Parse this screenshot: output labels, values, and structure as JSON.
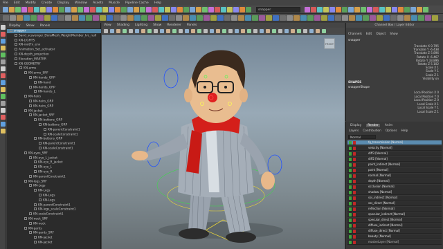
{
  "menubar": {
    "items": [
      "File",
      "Edit",
      "Modify",
      "Create",
      "Display",
      "Window",
      "Assets",
      "Muscle",
      "Pipeline Cache",
      "Help"
    ]
  },
  "shelf": {
    "search_value": "snapper"
  },
  "outliner": {
    "menu": [
      "Display",
      "Show",
      "Panels"
    ],
    "rows": [
      "snapper",
      "Sand_scavenger_DoraMesh_WeightMember_Ivc_null",
      "KN-LIGHTS",
      "KN-rootFx_env",
      "Animation_Set_activator",
      "KN-depth_projection",
      "Elevation_MASTER",
      "KN-GEOMETRY",
      "KN-arms",
      "KN-arms_SRF",
      "KN-hands_GRP",
      "KN-hand",
      "KN-hands_GRP",
      "KN-hands_L",
      "KN-hairs",
      "KN-hairs_GRP",
      "KN-hairs_GRP",
      "KN-jacket",
      "KN-jacket_SRF",
      "KN-buttons_GRP",
      "KN-buttons_GRP",
      "KN-parentConstraint1",
      "KN-scaleConstraint1",
      "KN-buttons_GRP",
      "KN-parentConstraint1",
      "KN-scaleConstraint1",
      "KN-eyes_SRF",
      "KN-eye_L_jacket",
      "KN-eye_R_jacket",
      "KN-eye_L",
      "KN-eye_R",
      "KN-parentConstraint1",
      "KN-legs_SRF",
      "KN-Legs",
      "KN-Legs",
      "KN-Legs",
      "KN-Legs",
      "KN-parentConstraint1",
      "KN-legs_scaleConstraint1",
      "KN-scaleConstraint1",
      "KN-neck_SRF",
      "KN-neck",
      "KN-pants",
      "KN-pants_SRF",
      "KN-jacket",
      "KN-jacket"
    ]
  },
  "viewport": {
    "menu": [
      "View",
      "Shading",
      "Lighting",
      "Show",
      "Renderer",
      "Panels"
    ],
    "viewcube_label": "FRONT"
  },
  "channelbox": {
    "title": "Channel Box / Layer Editor",
    "menu": [
      "Channels",
      "Edit",
      "Object",
      "Show"
    ],
    "node": "snapper",
    "attrs": [
      "Translate X  0.795",
      "Translate Y  -6.438",
      "Translate Z  5.896",
      "Rotate X  -6.467",
      "Rotate Y  33.896",
      "Rotate Z  5.102",
      "Scale X  1",
      "Scale Y  1",
      "Scale Z  1",
      "Visibility  on"
    ],
    "shapes_header": "SHAPES",
    "shape_name": "snapperShape",
    "local_attrs": [
      "Local Position X  0",
      "Local Position Y  0",
      "Local Position Z  0",
      "Local Scale X  1",
      "Local Scale Y  1",
      "Local Scale Z  1"
    ]
  },
  "layers": {
    "tabs": [
      "Display",
      "Render",
      "Anim"
    ],
    "active_tab": "Render",
    "menu": [
      "Layers",
      "Contribution",
      "Options",
      "Help"
    ],
    "dropdown": "Normal",
    "rows": [
      "fg_transmission [Normal]",
      "velocity [Normal]",
      "diff3 [Normal]",
      "diff2 [Normal]",
      "point_Indirect [Normal]",
      "point [Normal]",
      "normal [Normal]",
      "depth [Normal]",
      "occlusion [Normal]",
      "shadow [Normal]",
      "sss_indirect [Normal]",
      "sss_direct [Normal]",
      "reflection [Normal]",
      "specular_indirect [Normal]",
      "specular_direct [Normal]",
      "diffuse_indirect [Normal]",
      "diffuse_direct [Normal]",
      "beauty [Normal]",
      "masterLayer [Normal]"
    ]
  },
  "colors": {
    "selection": "#5285a6",
    "layer_visible": "#3fa43f",
    "layer_render": "#c02828",
    "scarf": "#d41f1a",
    "suit": "#9aa3ae"
  }
}
